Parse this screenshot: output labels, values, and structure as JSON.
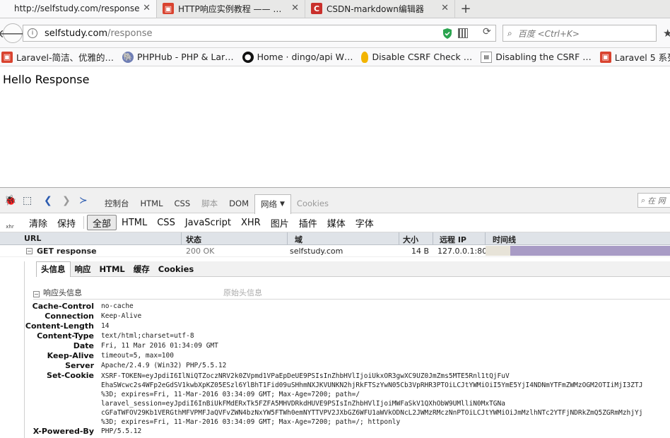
{
  "tabs": [
    {
      "title": "http://selfstudy.com/response",
      "active": true
    },
    {
      "title": "HTTP响应实例教程 —— …",
      "active": false
    },
    {
      "title": "CSDN-markdown编辑器",
      "active": false
    }
  ],
  "navbar": {
    "url_host": "selfstudy.com",
    "url_path": "/response",
    "search_placeholder": "百度 <Ctrl+K>"
  },
  "bookmarks": [
    "Laravel-简洁、优雅的…",
    "PHPHub - PHP & Lar…",
    "Home · dingo/api W…",
    "Disable CSRF Check …",
    "Disabling the CSRF …",
    "Laravel 5 系列入门教…"
  ],
  "page": {
    "heading": "Hello Response"
  },
  "devtools": {
    "tabs": [
      "控制台",
      "HTML",
      "CSS",
      "脚本",
      "DOM",
      "网络",
      "Cookies"
    ],
    "active_tab": "网络",
    "search_placeholder": "在 网",
    "filters": [
      "清除",
      "保持",
      "全部",
      "HTML",
      "CSS",
      "JavaScript",
      "XHR",
      "图片",
      "插件",
      "媒体",
      "字体"
    ],
    "columns": {
      "url": "URL",
      "status": "状态",
      "domain": "域",
      "size": "大小",
      "remote_ip": "远程 IP",
      "timeline": "时间线"
    },
    "request": {
      "method_url": "GET response",
      "status": "200 OK",
      "domain": "selfstudy.com",
      "size": "14 B",
      "remote_ip": "127.0.0.1:80"
    },
    "detail_tabs": [
      "头信息",
      "响应",
      "HTML",
      "缓存",
      "Cookies"
    ],
    "response_headers_title": "响应头信息",
    "raw_headers_label": "原始头信息",
    "headers": [
      {
        "name": "Cache-Control",
        "value": "no-cache"
      },
      {
        "name": "Connection",
        "value": "Keep-Alive"
      },
      {
        "name": "Content-Length",
        "value": "14"
      },
      {
        "name": "Content-Type",
        "value": "text/html;charset=utf-8"
      },
      {
        "name": "Date",
        "value": "Fri, 11 Mar 2016 01:34:09 GMT"
      },
      {
        "name": "Keep-Alive",
        "value": "timeout=5, max=100"
      },
      {
        "name": "Server",
        "value": "Apache/2.4.9 (Win32) PHP/5.5.12"
      }
    ],
    "set_cookie": {
      "name": "Set-Cookie",
      "value": "XSRF-TOKEN=eyJpdiI6IlNiQTZoczNRV2k0ZVpmd1VPaEpDeUE9PSIsInZhbHVlIjoiUkxOR3gwXC9UZ0JmZms5MTE5Rnl1tQjFuV\nEhaSWcwc2s4WFp2eGdSV1kwbXpKZ05ESzl6YlBhT1Fid09uSHhmNXJKVUNKN2hjRkFTSzYwN05Cb3VpRHR3PTOiLCJtYWMiOiI5YmE5YjI4NDNmYTFmZWMzOGM2OTIiMjI3ZTJ\n%3D; expires=Fri, 11-Mar-2016 03:34:09 GMT; Max-Age=7200; path=/\nlaravel_session=eyJpdiI6InBiUkFMdERxTk5FZFA5MHVDRkdHUVE9PSIsInZhbHVlIjoiMWFaSkV1QXhObW9UMlliN0MxTGNa\ncGFaTWFOV29Kb1VERGthMFVPMFJaQVFvZWN4bzNxYW5FTWh0emNYTTVPV2JXbGZ6WFU1aWVkODNcL2JWMzRMczNnPTOiLCJtYWMiOiJmMzlhNTc2YTFjNDRkZmQ5ZGRmMzhjYj\n%3D; expires=Fri, 11-Mar-2016 03:34:09 GMT; Max-Age=7200; path=/; httponly"
    },
    "x_powered_by": {
      "name": "X-Powered-By",
      "value": "PHP/5.5.12"
    }
  }
}
